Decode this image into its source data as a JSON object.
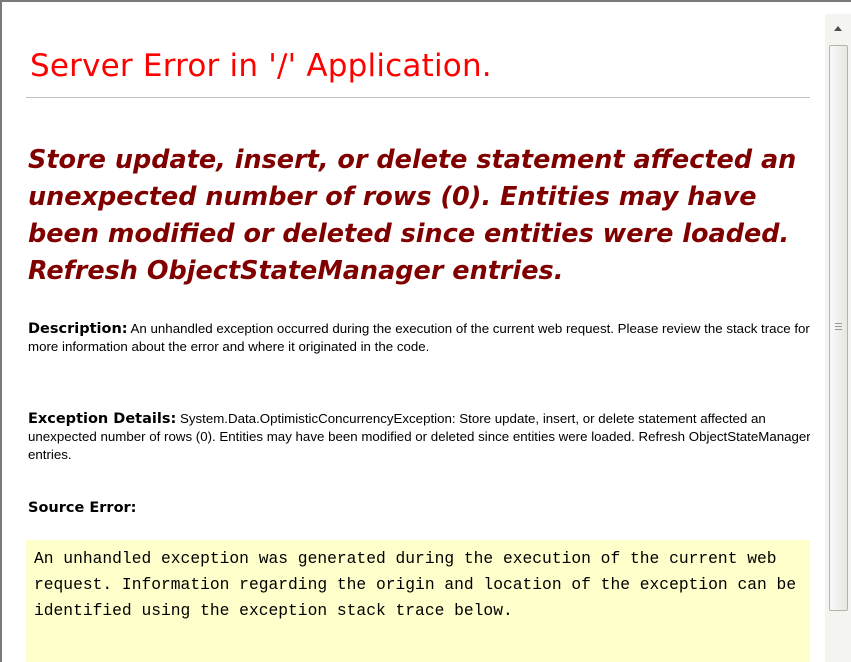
{
  "page": {
    "title": "Server Error in '/' Application.",
    "error_message": "Store update, insert, or delete statement affected an unexpected number of rows (0). Entities may have been modified or deleted since entities were loaded. Refresh ObjectStateManager entries.",
    "description_label": "Description:",
    "description_text": " An unhandled exception occurred during the execution of the current web request. Please review the stack trace for more information about the error and where it originated in the code.",
    "exception_label": "Exception Details:",
    "exception_text": " System.Data.OptimisticConcurrencyException: Store update, insert, or delete statement affected an unexpected number of rows (0). Entities may have been modified or deleted since entities were loaded. Refresh ObjectStateManager entries.",
    "source_error_label": "Source Error:",
    "source_error_text": "An unhandled exception was generated during the execution of the current web request. Information regarding the origin and location of the exception can be identified using the exception stack trace below."
  },
  "colors": {
    "title": "#ff0000",
    "error_message": "#800000",
    "source_box_bg": "#ffffcc"
  },
  "icons": {
    "scroll_up": "triangle-up-icon",
    "thumb_grip": "grip-lines-icon"
  }
}
